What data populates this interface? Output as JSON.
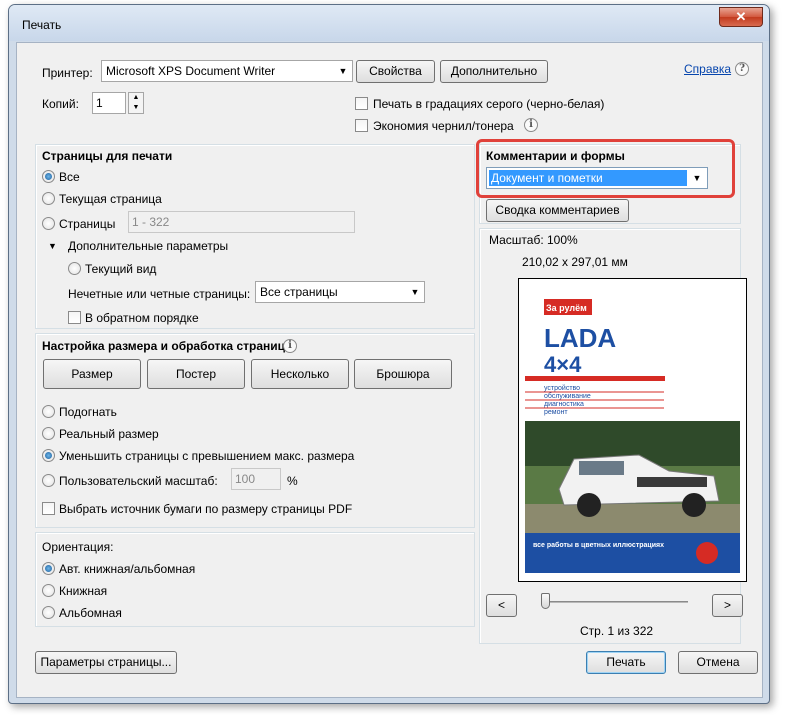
{
  "window": {
    "title": "Печать",
    "close_glyph": "✕"
  },
  "printer": {
    "label": "Принтер:",
    "value": "Microsoft XPS Document Writer",
    "properties_button": "Свойства",
    "advanced_button": "Дополнительно",
    "help_link": "Справка",
    "help_icon": "?"
  },
  "copies": {
    "label": "Копий:",
    "value": "1"
  },
  "options": {
    "grayscale": "Печать в градациях серого (черно-белая)",
    "save_ink": "Экономия чернил/тонера",
    "info_icon": "i"
  },
  "pages": {
    "heading": "Страницы для печати",
    "all": "Все",
    "current": "Текущая страница",
    "pages_label": "Страницы",
    "pages_value": "1 - 322",
    "more_options": "Дополнительные параметры",
    "current_view": "Текущий вид",
    "odd_even_label": "Нечетные или четные страницы:",
    "odd_even_value": "Все страницы",
    "reverse": "В обратном порядке"
  },
  "sizing": {
    "heading": "Настройка размера и обработка страниц",
    "info_icon": "i",
    "buttons": [
      "Размер",
      "Постер",
      "Несколько",
      "Брошюра"
    ],
    "fit": "Подогнать",
    "actual": "Реальный размер",
    "shrink": "Уменьшить страницы с превышением макс. размера",
    "custom": "Пользовательский масштаб:",
    "custom_value": "100",
    "percent": "%",
    "paper_source": "Выбрать источник бумаги по размеру страницы PDF"
  },
  "orientation": {
    "heading": "Ориентация:",
    "auto": "Авт. книжная/альбомная",
    "portrait": "Книжная",
    "landscape": "Альбомная"
  },
  "comments": {
    "heading": "Комментарии и формы",
    "value": "Документ и пометки",
    "summary_button": "Сводка комментариев"
  },
  "preview": {
    "scale": "Масштаб: 100%",
    "dimensions": "210,02 x 297,01 мм",
    "prev": "<",
    "next": ">",
    "page_info": "Стр. 1 из 322",
    "cover": {
      "logo": "За рулём",
      "title_line1": "LADA",
      "title_line2": "4×4",
      "lines": [
        "устройство",
        "обслуживание",
        "диагностика",
        "ремонт"
      ],
      "footer": "все работы в цветных иллюстрациях"
    }
  },
  "footer": {
    "page_setup": "Параметры страницы...",
    "print": "Печать",
    "cancel": "Отмена"
  }
}
